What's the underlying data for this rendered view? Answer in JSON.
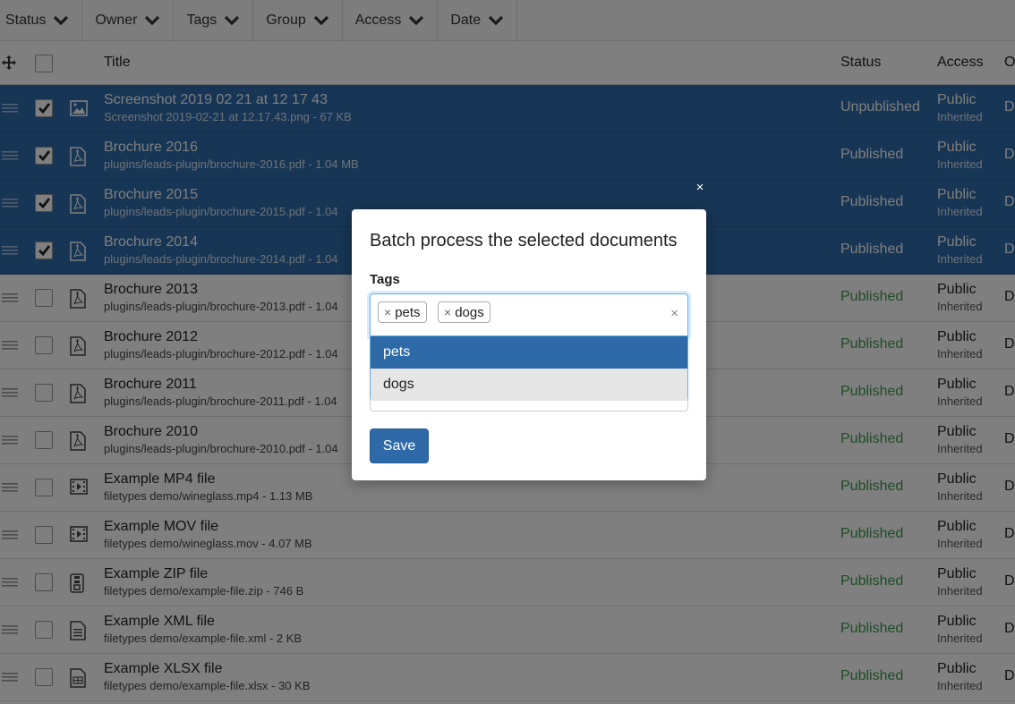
{
  "filters": [
    {
      "label": "Status"
    },
    {
      "label": "Owner"
    },
    {
      "label": "Tags"
    },
    {
      "label": "Group"
    },
    {
      "label": "Access"
    },
    {
      "label": "Date"
    }
  ],
  "table": {
    "headers": {
      "title": "Title",
      "status": "Status",
      "access": "Access",
      "owner": "O"
    },
    "rows": [
      {
        "title": "Screenshot 2019 02 21 at 12 17 43",
        "sub": "Screenshot 2019-02-21 at 12.17.43.png - 67 KB",
        "status": "Unpublished",
        "access": "Public",
        "access_sub": "Inherited",
        "owner": "D",
        "selected": true,
        "icon": "image-file-icon"
      },
      {
        "title": "Brochure 2016",
        "sub": "plugins/leads-plugin/brochure-2016.pdf - 1.04 MB",
        "status": "Published",
        "access": "Public",
        "access_sub": "Inherited",
        "owner": "D",
        "selected": true,
        "icon": "pdf-file-icon"
      },
      {
        "title": "Brochure 2015",
        "sub": "plugins/leads-plugin/brochure-2015.pdf - 1.04",
        "status": "Published",
        "access": "Public",
        "access_sub": "Inherited",
        "owner": "D",
        "selected": true,
        "icon": "pdf-file-icon"
      },
      {
        "title": "Brochure 2014",
        "sub": "plugins/leads-plugin/brochure-2014.pdf - 1.04",
        "status": "Published",
        "access": "Public",
        "access_sub": "Inherited",
        "owner": "D",
        "selected": true,
        "icon": "pdf-file-icon"
      },
      {
        "title": "Brochure 2013",
        "sub": "plugins/leads-plugin/brochure-2013.pdf - 1.04",
        "status": "Published",
        "access": "Public",
        "access_sub": "Inherited",
        "owner": "D",
        "selected": false,
        "icon": "pdf-file-icon"
      },
      {
        "title": "Brochure 2012",
        "sub": "plugins/leads-plugin/brochure-2012.pdf - 1.04",
        "status": "Published",
        "access": "Public",
        "access_sub": "Inherited",
        "owner": "D",
        "selected": false,
        "icon": "pdf-file-icon"
      },
      {
        "title": "Brochure 2011",
        "sub": "plugins/leads-plugin/brochure-2011.pdf - 1.04",
        "status": "Published",
        "access": "Public",
        "access_sub": "Inherited",
        "owner": "D",
        "selected": false,
        "icon": "pdf-file-icon"
      },
      {
        "title": "Brochure 2010",
        "sub": "plugins/leads-plugin/brochure-2010.pdf - 1.04",
        "status": "Published",
        "access": "Public",
        "access_sub": "Inherited",
        "owner": "D",
        "selected": false,
        "icon": "pdf-file-icon"
      },
      {
        "title": "Example MP4 file",
        "sub": "filetypes demo/wineglass.mp4 - 1.13 MB",
        "status": "Published",
        "access": "Public",
        "access_sub": "Inherited",
        "owner": "D",
        "selected": false,
        "icon": "video-file-icon"
      },
      {
        "title": "Example MOV file",
        "sub": "filetypes demo/wineglass.mov - 4.07 MB",
        "status": "Published",
        "access": "Public",
        "access_sub": "Inherited",
        "owner": "D",
        "selected": false,
        "icon": "video-file-icon"
      },
      {
        "title": "Example ZIP file",
        "sub": "filetypes demo/example-file.zip - 746 B",
        "status": "Published",
        "access": "Public",
        "access_sub": "Inherited",
        "owner": "D",
        "selected": false,
        "icon": "zip-file-icon"
      },
      {
        "title": "Example XML file",
        "sub": "filetypes demo/example-file.xml - 2 KB",
        "status": "Published",
        "access": "Public",
        "access_sub": "Inherited",
        "owner": "D",
        "selected": false,
        "icon": "text-file-icon"
      },
      {
        "title": "Example XLSX file",
        "sub": "filetypes demo/example-file.xlsx - 30 KB",
        "status": "Published",
        "access": "Public",
        "access_sub": "Inherited",
        "owner": "D",
        "selected": false,
        "icon": "spreadsheet-file-icon"
      }
    ]
  },
  "modal": {
    "close_label": "×",
    "title": "Batch process the selected documents",
    "tags_label": "Tags",
    "chips": [
      {
        "label": "pets",
        "remove": "×"
      },
      {
        "label": "dogs",
        "remove": "×"
      }
    ],
    "clear_label": "×",
    "options": [
      {
        "label": "pets",
        "highlighted": true
      },
      {
        "label": "dogs",
        "highlighted": false
      }
    ],
    "save_label": "Save"
  },
  "colors": {
    "selected_row": "#2e6aa8",
    "published": "#3b9b4c",
    "primary_button": "#2e6aa8"
  }
}
